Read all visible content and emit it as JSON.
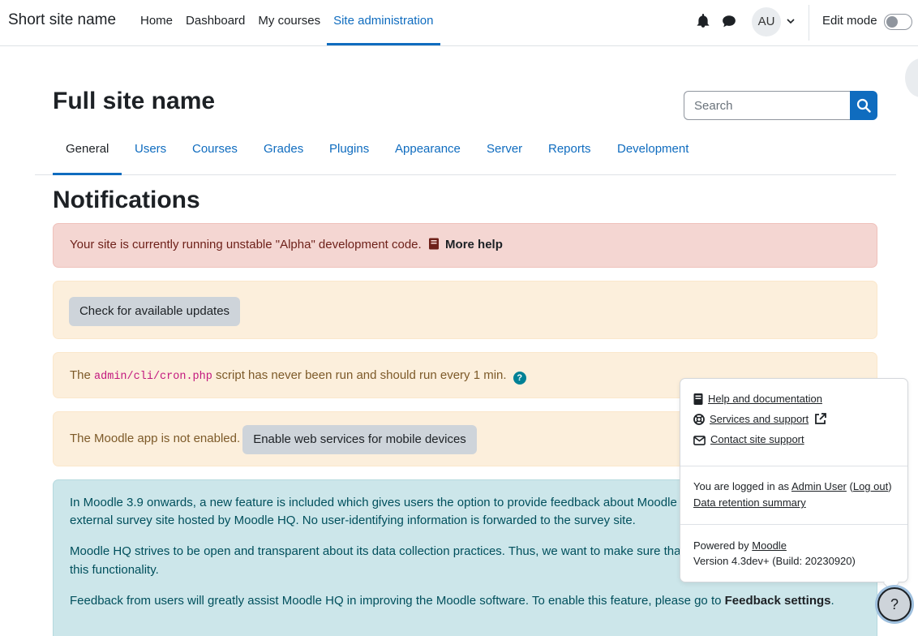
{
  "navbar": {
    "brand": "Short site name",
    "items": [
      {
        "label": "Home"
      },
      {
        "label": "Dashboard"
      },
      {
        "label": "My courses"
      },
      {
        "label": "Site administration"
      }
    ],
    "avatar_initials": "AU",
    "edit_mode_label": "Edit mode"
  },
  "header": {
    "title": "Full site name",
    "search_placeholder": "Search"
  },
  "tabs": [
    {
      "label": "General"
    },
    {
      "label": "Users"
    },
    {
      "label": "Courses"
    },
    {
      "label": "Grades"
    },
    {
      "label": "Plugins"
    },
    {
      "label": "Appearance"
    },
    {
      "label": "Server"
    },
    {
      "label": "Reports"
    },
    {
      "label": "Development"
    }
  ],
  "notifications": {
    "title": "Notifications",
    "alpha_text": "Your site is currently running unstable \"Alpha\" development code.",
    "alpha_link": "More help",
    "check_updates_button": "Check for available updates",
    "cron_prefix": "The",
    "cron_code": "admin/cli/cron.php",
    "cron_suffix": "script has never been run and should run every 1 min.",
    "mobile_text": "The Moodle app is not enabled.",
    "mobile_button": "Enable web services for mobile devices",
    "feedback_line1": "In Moodle 3.9 onwards, a new feature is included which gives users the option to provide feedback about Moodle s",
    "feedback_line2": "external survey site hosted by Moodle HQ. No user-identifying information is forwarded to the survey site.",
    "feedback_line3": "Moodle HQ strives to be open and transparent about its data collection practices. Thus, we want to make sure tha",
    "feedback_line4": "this functionality.",
    "feedback_line5_prefix": "Feedback from users will greatly assist Moodle HQ in improving the Moodle software. To enable this feature, please go to",
    "feedback_link": "Feedback settings",
    "feedback_line5_suffix": "."
  },
  "footer_popover": {
    "help_docs": "Help and documentation",
    "services_support": "Services and support",
    "contact_support": "Contact site support",
    "logged_in_prefix": "You are logged in as",
    "user_name": "Admin User",
    "logout": "Log out",
    "data_retention": "Data retention summary",
    "powered_by_prefix": "Powered by",
    "powered_by_link": "Moodle",
    "version": "Version 4.3dev+ (Build: 20230920)",
    "help_fab": "?"
  }
}
